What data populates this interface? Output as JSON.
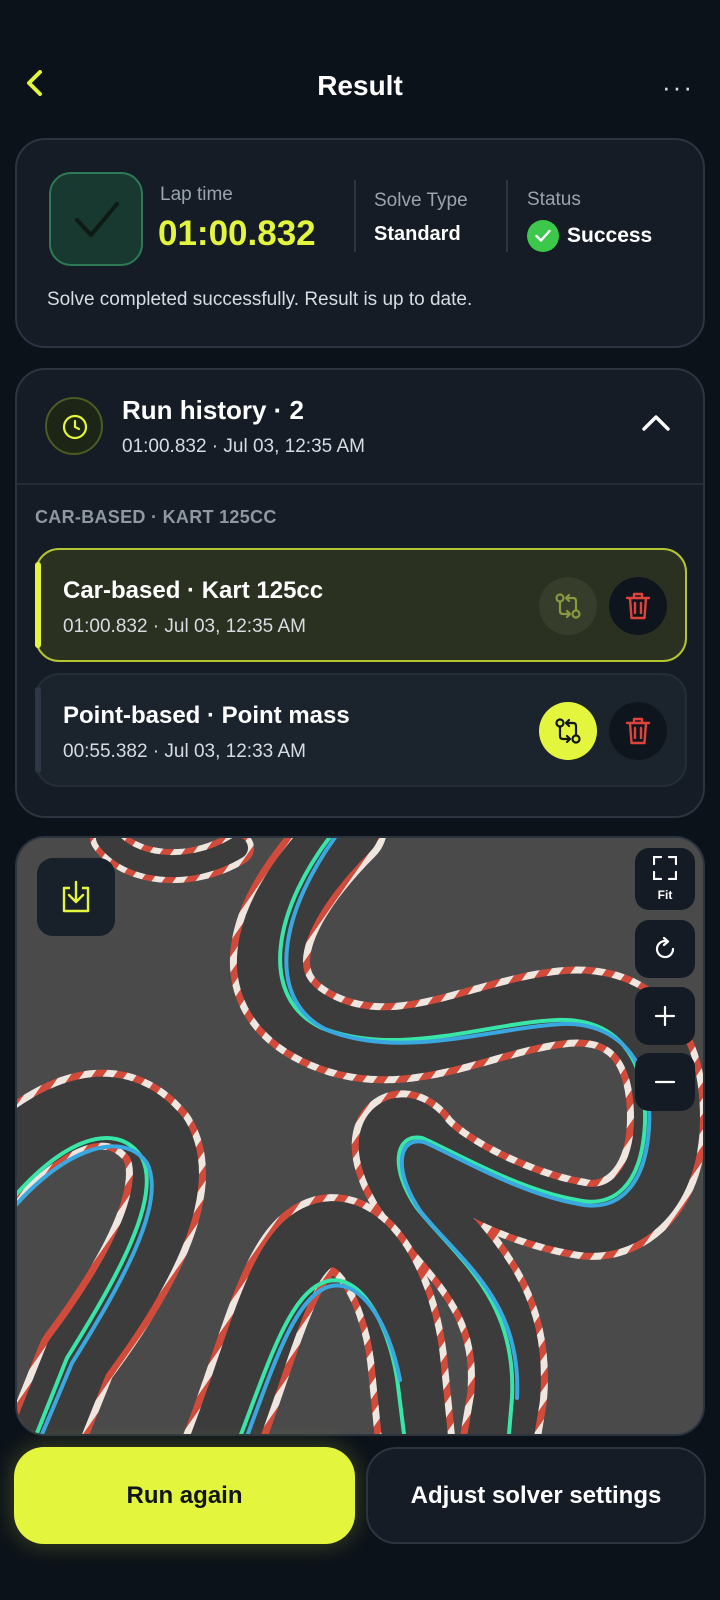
{
  "header": {
    "title": "Result",
    "more_label": "···"
  },
  "summary": {
    "lap_time_label": "Lap time",
    "lap_time_value": "01:00.832",
    "solve_type_label": "Solve Type",
    "solve_type_value": "Standard",
    "status_label": "Status",
    "status_value": "Success",
    "note": "Solve completed successfully. Result is up to date.",
    "colors": {
      "accent": "#e3f53c",
      "success": "#3cc84a"
    }
  },
  "history": {
    "title": "Run history · 2",
    "subtitle": "01:00.832 · Jul 03, 12:35 AM",
    "group_label": "CAR-BASED · KART 125CC",
    "runs": [
      {
        "title": "Car-based · Kart 125cc",
        "subtitle": "01:00.832 · Jul 03, 12:35 AM",
        "active": true
      },
      {
        "title": "Point-based · Point mass",
        "subtitle": "00:55.382 · Jul 03, 12:33 AM",
        "active": false
      }
    ]
  },
  "map": {
    "fit_label": "Fit",
    "icons": [
      "download-icon",
      "fit-icon",
      "reset-icon",
      "zoom-in-icon",
      "zoom-out-icon"
    ]
  },
  "actions": {
    "run_again": "Run again",
    "adjust_settings": "Adjust solver settings"
  }
}
